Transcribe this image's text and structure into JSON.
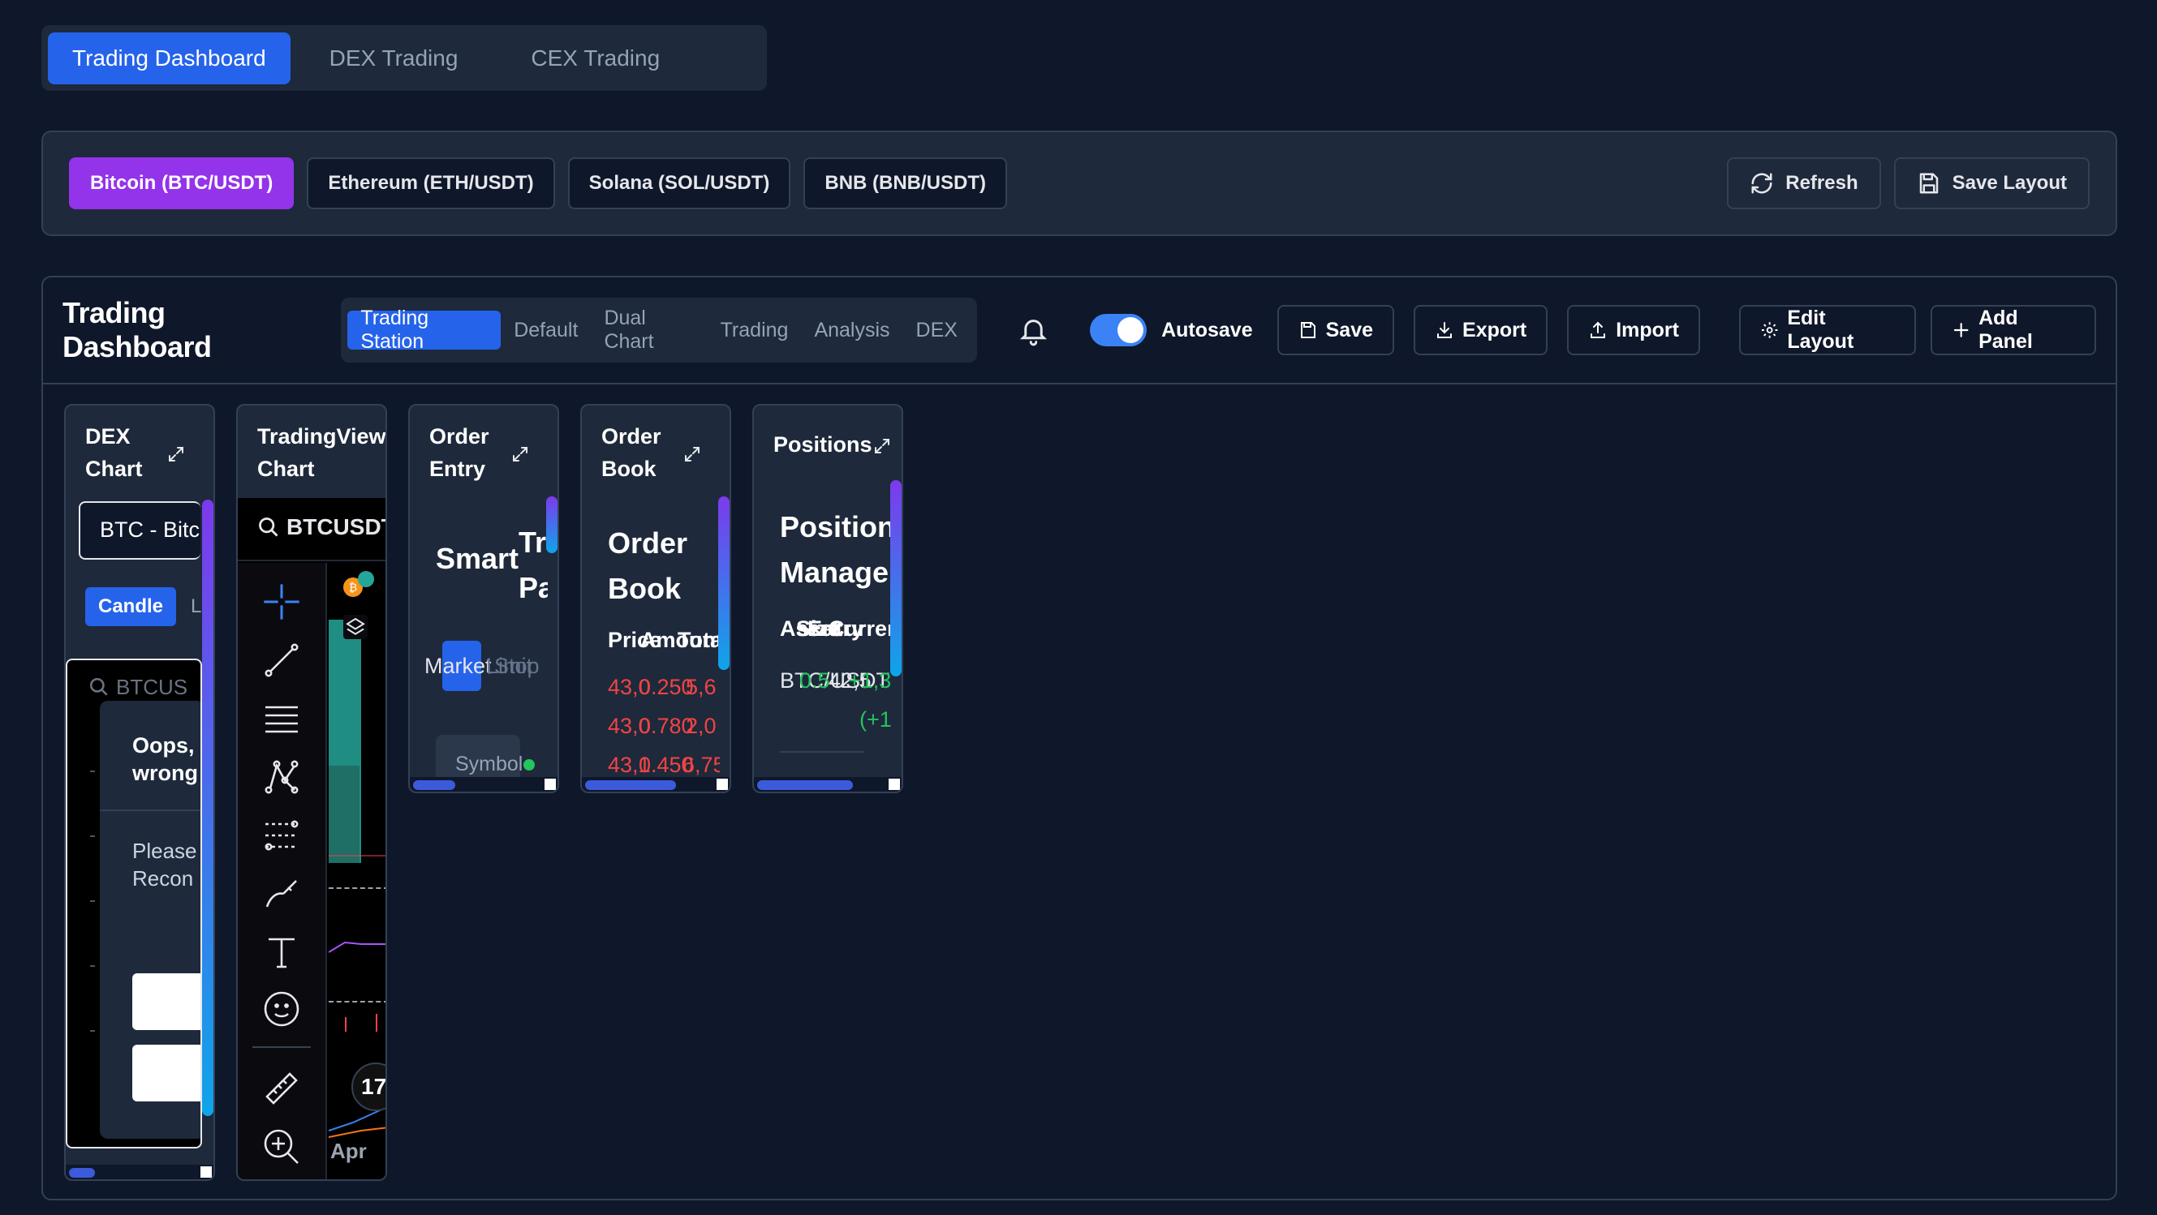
{
  "top_tabs": [
    "Trading Dashboard",
    "DEX Trading",
    "CEX Trading"
  ],
  "symbols": [
    "Bitcoin (BTC/USDT)",
    "Ethereum (ETH/USDT)",
    "Solana (SOL/USDT)",
    "BNB (BNB/USDT)"
  ],
  "actions": {
    "refresh": "Refresh",
    "save_layout": "Save Layout"
  },
  "dashboard": {
    "title": "Trading Dashboard",
    "layouts": [
      "Trading Station",
      "Default",
      "Dual Chart",
      "Trading",
      "Analysis",
      "DEX"
    ],
    "autosave_label": "Autosave",
    "autosave_on": true,
    "buttons": {
      "save": "Save",
      "export": "Export",
      "import": "Import",
      "edit_layout": "Edit Layout",
      "add_panel": "Add Panel"
    }
  },
  "panels": {
    "dex_chart": {
      "title_l1": "DEX",
      "title_l2": "Chart",
      "select_value": "BTC - Bitc",
      "candle": "Candle",
      "line_partial": "L",
      "search_partial": "BTCUS",
      "error_title_l1": "Oops,",
      "error_title_l2": "wrong",
      "error_body_l1": "Please",
      "error_body_l2": "Recon"
    },
    "tradingview": {
      "title_l1": "TradingView",
      "title_l2": "Chart",
      "search": "BTCUSDT",
      "axis_label": "Apr",
      "logo": "17"
    },
    "order_entry": {
      "title_l1": "Order",
      "title_l2": "Entry",
      "smart": "Smart",
      "tr": "Tr",
      "pa": "Pa",
      "market": "Market",
      "limit": "Limit",
      "stop": "Stop",
      "symbol": "Symbol"
    },
    "order_book": {
      "title_l1": "Order",
      "title_l2": "Book",
      "h1": "Order",
      "h2": "Book",
      "col_price": "Price",
      "col_amount": "Amount",
      "col_total": "Total",
      "rows": [
        {
          "price": "43,0",
          "amount": "0.250",
          "total": "5,6"
        },
        {
          "price": "43,0",
          "amount": "0.780",
          "total": "2,0"
        },
        {
          "price": "43,1",
          "amount": "0.450",
          "total": "6,75"
        }
      ]
    },
    "positions": {
      "title": "Positions",
      "h1": "Positions",
      "h2": "Manager",
      "col_asset": "Asset",
      "col_size": "Size",
      "col_entry": "Entry",
      "col_pnl": "Current",
      "row_asset": "BTC/USDT",
      "row_size": "0.5",
      "row_entry": "42,5",
      "row_pnl": "+1,3",
      "row_change": "(+1"
    }
  }
}
